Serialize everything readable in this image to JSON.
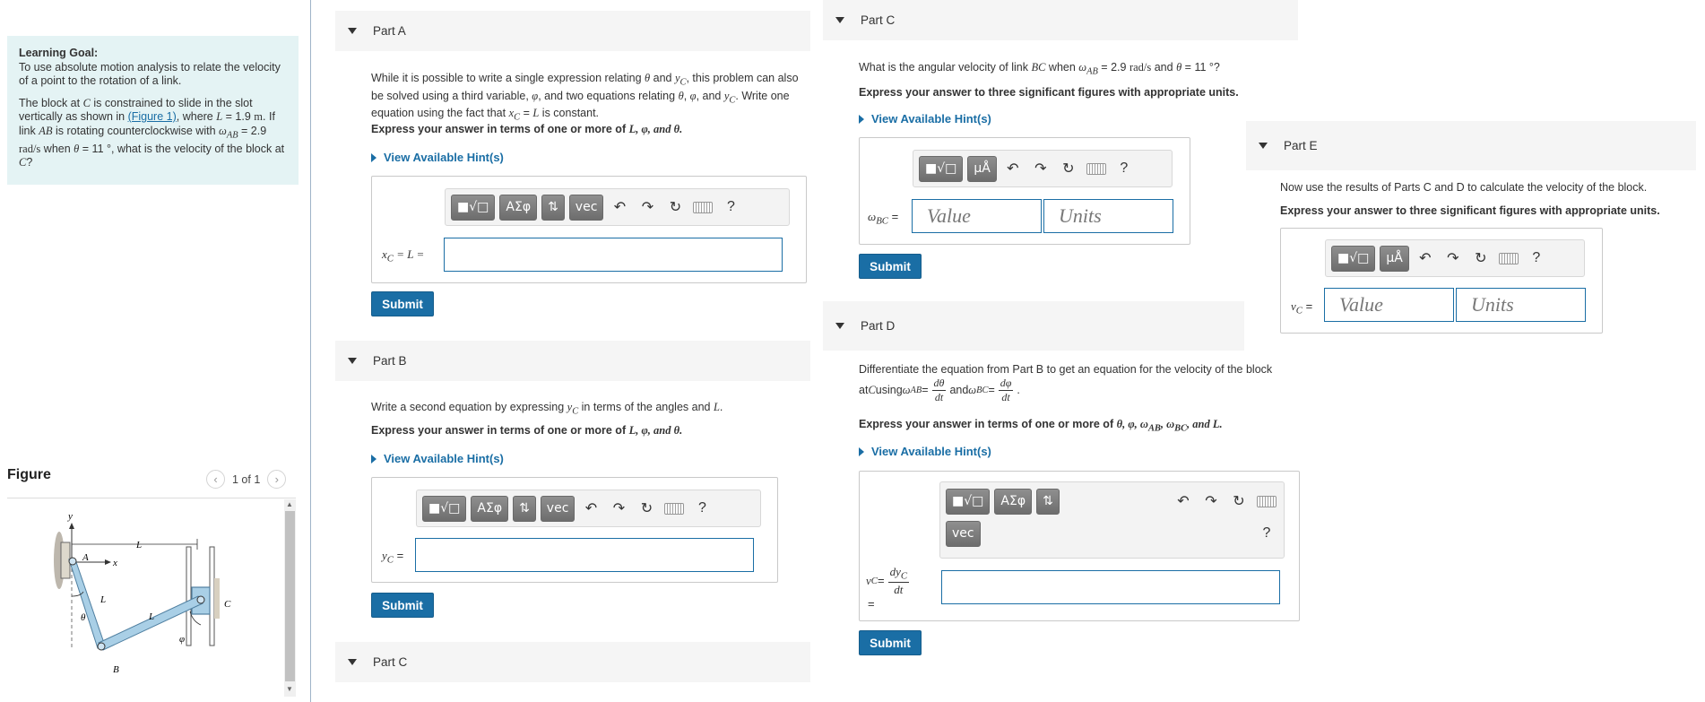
{
  "learning_goal": {
    "heading": "Learning Goal:",
    "text": "To use absolute motion analysis to relate the velocity of a point to the rotation of a link.",
    "problem_p1": "The block at ",
    "problem_C": "C",
    "problem_p2": " is constrained to slide in the slot vertically as shown in ",
    "figure_link": "(Figure 1)",
    "problem_p3": ", where ",
    "problem_L": "L",
    "problem_p4": " = 1.9 ",
    "problem_m": "m",
    "problem_p5": ". If link ",
    "problem_AB": "AB",
    "problem_p6": " is rotating counterclockwise with ",
    "problem_omega": "ω",
    "problem_AB_sub": "AB",
    "problem_p7": " = 2.9 ",
    "problem_rads": "rad/s",
    "problem_p8": " when ",
    "problem_theta": "θ",
    "problem_p9": " = 11 °, what is the velocity of the block at ",
    "problem_C2": "C",
    "problem_p10": "?"
  },
  "figure": {
    "title": "Figure",
    "pager": "1 of 1",
    "prev_icon": "chevron-left-icon",
    "next_icon": "chevron-right-icon",
    "labels": {
      "y": "y",
      "x": "x",
      "A": "A",
      "B": "B",
      "C": "C",
      "L1": "L",
      "L2": "L",
      "L3": "L",
      "theta": "θ",
      "phi": "φ"
    }
  },
  "toolbar": {
    "templates": "■√□",
    "greek": "ΑΣφ",
    "arrows": "⇅",
    "vec": "vec",
    "units": "μÅ",
    "help": "?",
    "undo": "↶",
    "redo": "↷",
    "reset": "↻"
  },
  "part_a": {
    "title": "Part A",
    "p1a": "While it is possible to write a single expression relating ",
    "p1_theta": "θ",
    "p1b": " and ",
    "p1_yc": "y",
    "p1_yc_sub": "C",
    "p1c": ", this problem can also be solved using a third variable, ",
    "p1_phi": "φ",
    "p1d": ", and two equations relating ",
    "p1_theta2": "θ",
    "p1e": ", ",
    "p1_phi2": "φ",
    "p1f": ", and ",
    "p1_yc2": "y",
    "p1_yc2_sub": "C",
    "p1g": ". Write one equation using the fact that ",
    "p1_xc": "x",
    "p1_xc_sub": "C",
    "p1h": " = ",
    "p1_L": "L",
    "p1i": " is constant.",
    "instr": "Express your answer in terms of one or more of ",
    "instr_vars": "L, φ, and θ.",
    "hint": "View Available Hint(s)",
    "label_x": "x",
    "label_x_sub": "C",
    "label_rest": " = L =",
    "submit": "Submit"
  },
  "part_b": {
    "title": "Part B",
    "p1a": "Write a second equation by expressing ",
    "p1_yc": "y",
    "p1_yc_sub": "C",
    "p1b": " in terms of the angles and ",
    "p1_L": "L",
    "p1c": ".",
    "instr": "Express your answer in terms of one or more of ",
    "instr_vars": "L, φ, and θ.",
    "hint": "View Available Hint(s)",
    "label_y": "y",
    "label_y_sub": "C",
    "label_rest": " =",
    "submit": "Submit"
  },
  "part_c_left": {
    "title": "Part C"
  },
  "part_c": {
    "title": "Part C",
    "q1": "What is the angular velocity of link ",
    "q_BC": "BC",
    "q2": " when ",
    "q_omega": "ω",
    "q_AB": "AB",
    "q3": " = 2.9 ",
    "q_rads": "rad/s",
    "q4": " and ",
    "q_theta": "θ",
    "q5": " = 11 °?",
    "instr": "Express your answer to three significant figures with appropriate units.",
    "hint": "View Available Hint(s)",
    "label_omega": "ω",
    "label_sub": "BC",
    "label_rest": " =",
    "value_placeholder": "Value",
    "units_placeholder": "Units",
    "submit": "Submit"
  },
  "part_d": {
    "title": "Part D",
    "p1": "Differentiate the equation from Part B to get an equation for the velocity of the block",
    "p2a": "at ",
    "p2_C": "C",
    "p2b": " using ",
    "p2_omega1": "ω",
    "p2_AB": "AB",
    "p2_eq1": " = ",
    "frac1_num": "dθ",
    "frac1_den": "dt",
    "p2c": " and ",
    "p2_omega2": "ω",
    "p2_BC": "BC",
    "p2_eq2": " = ",
    "frac2_num": "dφ",
    "frac2_den": "dt",
    "p2d": ".",
    "instr": "Express your answer in terms of one or more of ",
    "instr_vars": "θ, φ, ω",
    "instr_sub1": "AB",
    "instr_mid": ", ω",
    "instr_sub2": "BC",
    "instr_end": ", and L.",
    "hint": "View Available Hint(s)",
    "label_v": "v",
    "label_v_sub": "C",
    "label_eq": " = ",
    "label_frac_num": "dy",
    "label_frac_num_sub": "C",
    "label_frac_den": "dt",
    "label_eq2": "=",
    "submit": "Submit"
  },
  "part_e": {
    "title": "Part E",
    "p1": "Now use the results of Parts C and D to calculate the velocity of the block.",
    "instr": "Express your answer to three significant figures with appropriate units.",
    "label_v": "v",
    "label_sub": "C",
    "label_rest": " =",
    "value_placeholder": "Value",
    "units_placeholder": "Units"
  }
}
